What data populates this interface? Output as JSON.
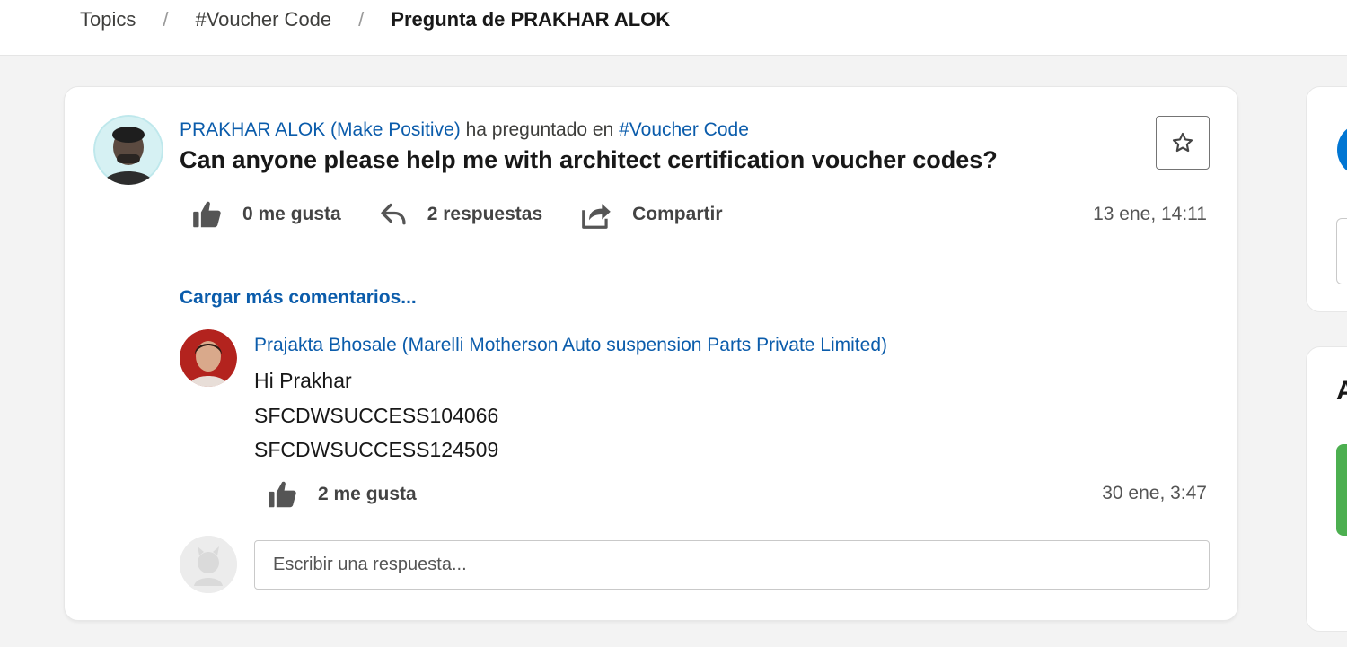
{
  "breadcrumb": {
    "items": [
      "Topics",
      "#Voucher Code"
    ],
    "separator": "/",
    "current": "Pregunta de PRAKHAR ALOK"
  },
  "question": {
    "author": "PRAKHAR ALOK (Make Positive)",
    "asked_in_text": "ha preguntado en",
    "topic": "#Voucher Code",
    "title": "Can anyone please help me with architect certification voucher codes?",
    "likes_label": "0 me gusta",
    "replies_label": "2 respuestas",
    "share_label": "Compartir",
    "timestamp": "13 ene, 14:11"
  },
  "comments": {
    "load_more_label": "Cargar más comentarios..."
  },
  "comment": {
    "author": "Prajakta Bhosale (Marelli Motherson Auto suspension Parts Private Limited)",
    "lines": [
      "Hi Prakhar",
      "SFCDWSUCCESS104066",
      "SFCDWSUCCESS124509"
    ],
    "likes_label": "2 me gusta",
    "timestamp": "30 ene, 3:47"
  },
  "reply": {
    "placeholder": "Escribir una respuesta..."
  },
  "sidebar": {
    "card2_heading_partial": "A"
  },
  "colors": {
    "link": "#0b5cab",
    "brand_blue": "#0176d3",
    "green": "#4caf50"
  },
  "icons": [
    "star-icon",
    "thumbs-up-icon",
    "reply-icon",
    "share-icon",
    "user-avatar-placeholder-icon"
  ]
}
